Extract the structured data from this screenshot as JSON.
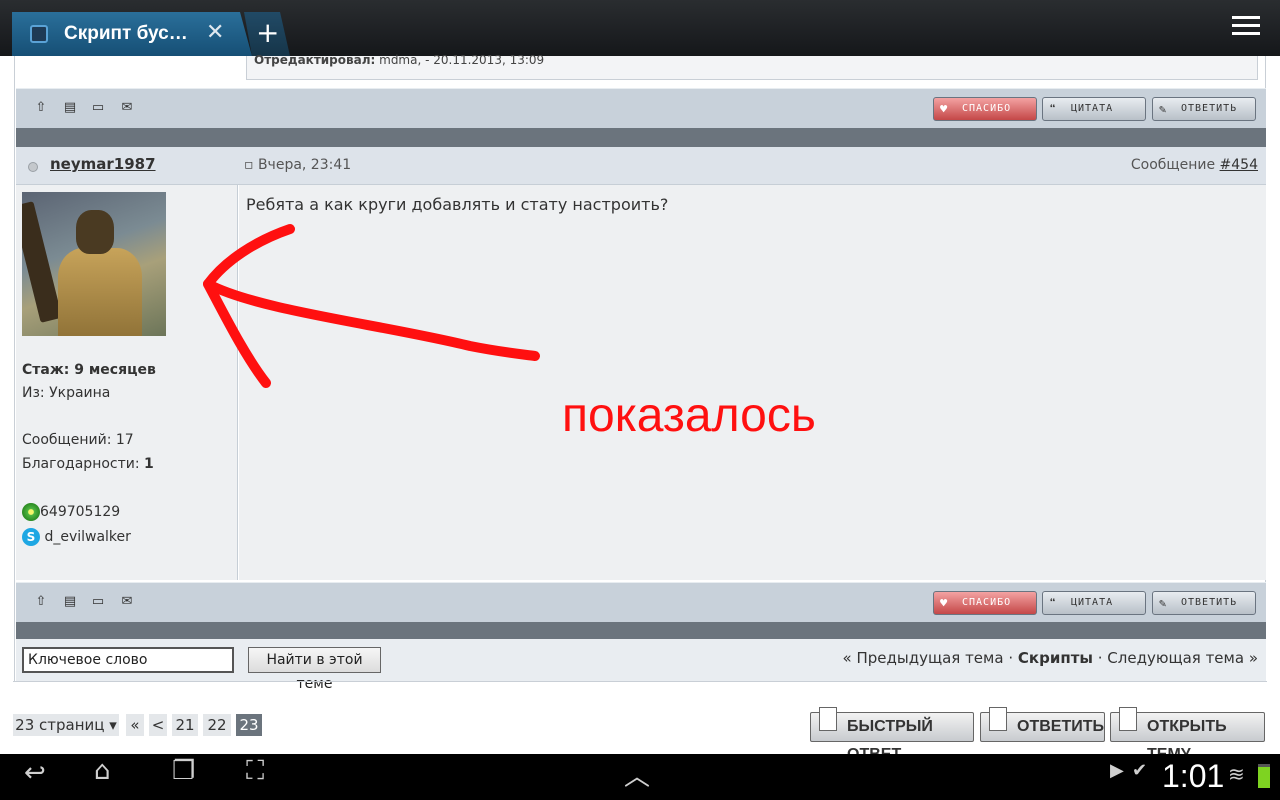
{
  "browser": {
    "tab_title": "Скрипт бус…",
    "tab_close": "✕",
    "new_tab": "+"
  },
  "prev_post": {
    "edited_label": "Отредактировал:",
    "edited_value": "mdma, - 20.11.2013, 13:09"
  },
  "actions": {
    "thanks": "СПАСИБО",
    "quote": "ЦИТАТА",
    "reply": "ОТВЕТИТЬ"
  },
  "post": {
    "username": "neymar1987",
    "date": "Вчера, 23:41",
    "message_label": "Сообщение",
    "message_number": "#454",
    "text": "Ребята а как круги добавлять и стату настроить?",
    "experience": "Стаж: 9 месяцев",
    "from": "Из: Украина",
    "messages_count": "Сообщений: 17",
    "thanks_label": "Благодарности:",
    "thanks_value": "1",
    "icq": "649705129",
    "skype": "d_evilwalker"
  },
  "annotation": {
    "text": "показалось",
    "color": "#ff1010"
  },
  "search": {
    "placeholder": "Ключевое слово",
    "button": "Найти в этой теме"
  },
  "topic_nav": {
    "prev": "« Предыдущая тема",
    "sep1": "·",
    "current": "Скрипты",
    "sep2": "·",
    "next": "Следующая тема »"
  },
  "pagination": {
    "pages_label": "23 страниц",
    "first": "«",
    "prev": "<",
    "pages": [
      "21",
      "22",
      "23"
    ],
    "current": "23"
  },
  "bottom_buttons": {
    "quick_reply": "БЫСТРЫЙ ОТВЕТ",
    "reply": "ОТВЕТИТЬ",
    "new_topic": "ОТКРЫТЬ ТЕМУ"
  },
  "system": {
    "clock": "1:01"
  }
}
